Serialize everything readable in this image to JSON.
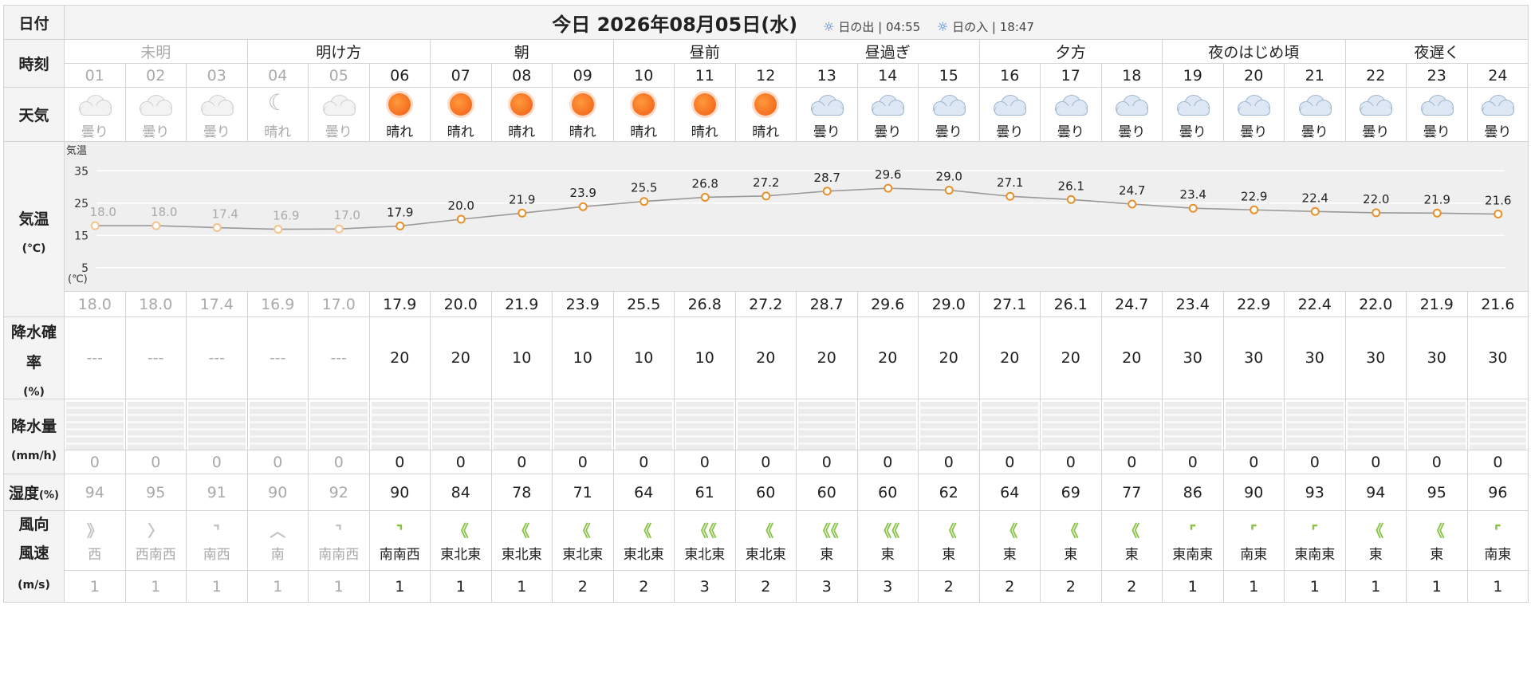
{
  "labels": {
    "date": "日付",
    "time": "時刻",
    "weather": "天気",
    "temp": "気温",
    "temp_unit": "(℃)",
    "precip_prob": "降水確率",
    "precip_prob_unit": "(%)",
    "precip_amt": "降水量",
    "precip_amt_unit": "(mm/h)",
    "humidity": "湿度",
    "humidity_unit": "(%)",
    "wind_dir": "風向",
    "wind_speed": "風速",
    "wind_unit": "(m/s)"
  },
  "header": {
    "title": "今日 2026年08月05日(水)",
    "sunrise_label": "日の出",
    "sunrise_time": "04:55",
    "sunset_label": "日の入",
    "sunset_time": "18:47",
    "separator": "|"
  },
  "periods": [
    {
      "label": "未明",
      "span": 3,
      "dim": true
    },
    {
      "label": "明け方",
      "span": 3,
      "dim": false
    },
    {
      "label": "朝",
      "span": 3,
      "dim": false
    },
    {
      "label": "昼前",
      "span": 3,
      "dim": false
    },
    {
      "label": "昼過ぎ",
      "span": 3,
      "dim": false
    },
    {
      "label": "夕方",
      "span": 3,
      "dim": false
    },
    {
      "label": "夜のはじめ頃",
      "span": 3,
      "dim": false
    },
    {
      "label": "夜遅く",
      "span": 3,
      "dim": false
    }
  ],
  "hours": [
    {
      "hour": "01",
      "past": true,
      "icon": "cloud-icon",
      "weather": "曇り",
      "temp": "18.0",
      "pop": "---",
      "precip": "0",
      "humidity": "94",
      "wind_dir": "西",
      "wind_icon": "wind-arrow-icon",
      "wind_glyph": "》",
      "wind_speed": "1"
    },
    {
      "hour": "02",
      "past": true,
      "icon": "cloud-icon",
      "weather": "曇り",
      "temp": "18.0",
      "pop": "---",
      "precip": "0",
      "humidity": "95",
      "wind_dir": "西南西",
      "wind_icon": "wind-arrow-icon",
      "wind_glyph": "〉",
      "wind_speed": "1"
    },
    {
      "hour": "03",
      "past": true,
      "icon": "cloud-icon",
      "weather": "曇り",
      "temp": "17.4",
      "pop": "---",
      "precip": "0",
      "humidity": "91",
      "wind_dir": "南西",
      "wind_icon": "wind-arrow-icon",
      "wind_glyph": "⌝",
      "wind_speed": "1"
    },
    {
      "hour": "04",
      "past": true,
      "icon": "moon-icon",
      "weather": "晴れ",
      "temp": "16.9",
      "pop": "---",
      "precip": "0",
      "humidity": "90",
      "wind_dir": "南",
      "wind_icon": "wind-arrow-icon",
      "wind_glyph": "︿",
      "wind_speed": "1"
    },
    {
      "hour": "05",
      "past": true,
      "icon": "cloud-icon",
      "weather": "曇り",
      "temp": "17.0",
      "pop": "---",
      "precip": "0",
      "humidity": "92",
      "wind_dir": "南南西",
      "wind_icon": "wind-arrow-icon",
      "wind_glyph": "⌝",
      "wind_speed": "1"
    },
    {
      "hour": "06",
      "past": false,
      "icon": "sun-icon",
      "weather": "晴れ",
      "temp": "17.9",
      "pop": "20",
      "precip": "0",
      "humidity": "90",
      "wind_dir": "南南西",
      "wind_icon": "wind-arrow-icon",
      "wind_glyph": "⌝",
      "wind_speed": "1"
    },
    {
      "hour": "07",
      "past": false,
      "icon": "sun-icon",
      "weather": "晴れ",
      "temp": "20.0",
      "pop": "20",
      "precip": "0",
      "humidity": "84",
      "wind_dir": "東北東",
      "wind_icon": "wind-arrow-icon",
      "wind_glyph": "《",
      "wind_speed": "1"
    },
    {
      "hour": "08",
      "past": false,
      "icon": "sun-icon",
      "weather": "晴れ",
      "temp": "21.9",
      "pop": "10",
      "precip": "0",
      "humidity": "78",
      "wind_dir": "東北東",
      "wind_icon": "wind-arrow-icon",
      "wind_glyph": "《",
      "wind_speed": "1"
    },
    {
      "hour": "09",
      "past": false,
      "icon": "sun-icon",
      "weather": "晴れ",
      "temp": "23.9",
      "pop": "10",
      "precip": "0",
      "humidity": "71",
      "wind_dir": "東北東",
      "wind_icon": "wind-arrow-icon",
      "wind_glyph": "《",
      "wind_speed": "2"
    },
    {
      "hour": "10",
      "past": false,
      "icon": "sun-icon",
      "weather": "晴れ",
      "temp": "25.5",
      "pop": "10",
      "precip": "0",
      "humidity": "64",
      "wind_dir": "東北東",
      "wind_icon": "wind-arrow-icon",
      "wind_glyph": "《",
      "wind_speed": "2"
    },
    {
      "hour": "11",
      "past": false,
      "icon": "sun-icon",
      "weather": "晴れ",
      "temp": "26.8",
      "pop": "10",
      "precip": "0",
      "humidity": "61",
      "wind_dir": "東北東",
      "wind_icon": "wind-arrow-icon",
      "wind_glyph": "《《",
      "wind_speed": "3"
    },
    {
      "hour": "12",
      "past": false,
      "icon": "sun-icon",
      "weather": "晴れ",
      "temp": "27.2",
      "pop": "20",
      "precip": "0",
      "humidity": "60",
      "wind_dir": "東北東",
      "wind_icon": "wind-arrow-icon",
      "wind_glyph": "《",
      "wind_speed": "2"
    },
    {
      "hour": "13",
      "past": false,
      "icon": "cloud-icon",
      "weather": "曇り",
      "temp": "28.7",
      "pop": "20",
      "precip": "0",
      "humidity": "60",
      "wind_dir": "東",
      "wind_icon": "wind-arrow-icon",
      "wind_glyph": "《《",
      "wind_speed": "3"
    },
    {
      "hour": "14",
      "past": false,
      "icon": "cloud-icon",
      "weather": "曇り",
      "temp": "29.6",
      "pop": "20",
      "precip": "0",
      "humidity": "60",
      "wind_dir": "東",
      "wind_icon": "wind-arrow-icon",
      "wind_glyph": "《《",
      "wind_speed": "3"
    },
    {
      "hour": "15",
      "past": false,
      "icon": "cloud-icon",
      "weather": "曇り",
      "temp": "29.0",
      "pop": "20",
      "precip": "0",
      "humidity": "62",
      "wind_dir": "東",
      "wind_icon": "wind-arrow-icon",
      "wind_glyph": "《",
      "wind_speed": "2"
    },
    {
      "hour": "16",
      "past": false,
      "icon": "cloud-icon",
      "weather": "曇り",
      "temp": "27.1",
      "pop": "20",
      "precip": "0",
      "humidity": "64",
      "wind_dir": "東",
      "wind_icon": "wind-arrow-icon",
      "wind_glyph": "《",
      "wind_speed": "2"
    },
    {
      "hour": "17",
      "past": false,
      "icon": "cloud-icon",
      "weather": "曇り",
      "temp": "26.1",
      "pop": "20",
      "precip": "0",
      "humidity": "69",
      "wind_dir": "東",
      "wind_icon": "wind-arrow-icon",
      "wind_glyph": "《",
      "wind_speed": "2"
    },
    {
      "hour": "18",
      "past": false,
      "icon": "cloud-icon",
      "weather": "曇り",
      "temp": "24.7",
      "pop": "20",
      "precip": "0",
      "humidity": "77",
      "wind_dir": "東",
      "wind_icon": "wind-arrow-icon",
      "wind_glyph": "《",
      "wind_speed": "2"
    },
    {
      "hour": "19",
      "past": false,
      "icon": "cloud-icon",
      "weather": "曇り",
      "temp": "23.4",
      "pop": "30",
      "precip": "0",
      "humidity": "86",
      "wind_dir": "東南東",
      "wind_icon": "wind-arrow-icon",
      "wind_glyph": "⌜",
      "wind_speed": "1"
    },
    {
      "hour": "20",
      "past": false,
      "icon": "cloud-icon",
      "weather": "曇り",
      "temp": "22.9",
      "pop": "30",
      "precip": "0",
      "humidity": "90",
      "wind_dir": "南東",
      "wind_icon": "wind-arrow-icon",
      "wind_glyph": "⌜",
      "wind_speed": "1"
    },
    {
      "hour": "21",
      "past": false,
      "icon": "cloud-icon",
      "weather": "曇り",
      "temp": "22.4",
      "pop": "30",
      "precip": "0",
      "humidity": "93",
      "wind_dir": "東南東",
      "wind_icon": "wind-arrow-icon",
      "wind_glyph": "⌜",
      "wind_speed": "1"
    },
    {
      "hour": "22",
      "past": false,
      "icon": "cloud-icon",
      "weather": "曇り",
      "temp": "22.0",
      "pop": "30",
      "precip": "0",
      "humidity": "94",
      "wind_dir": "東",
      "wind_icon": "wind-arrow-icon",
      "wind_glyph": "《",
      "wind_speed": "1"
    },
    {
      "hour": "23",
      "past": false,
      "icon": "cloud-icon",
      "weather": "曇り",
      "temp": "21.9",
      "pop": "30",
      "precip": "0",
      "humidity": "95",
      "wind_dir": "東",
      "wind_icon": "wind-arrow-icon",
      "wind_glyph": "《",
      "wind_speed": "1"
    },
    {
      "hour": "24",
      "past": false,
      "icon": "cloud-icon",
      "weather": "曇り",
      "temp": "21.6",
      "pop": "30",
      "precip": "0",
      "humidity": "96",
      "wind_dir": "南東",
      "wind_icon": "wind-arrow-icon",
      "wind_glyph": "⌜",
      "wind_speed": "1"
    }
  ],
  "colors": {
    "line": "#999999",
    "point_active": "#e8902a",
    "point_past": "#f3c48f",
    "wind_active": "#8bc34a",
    "wind_past": "#c4c4c4",
    "grid": "#ffffff",
    "chart_bg": "#efefef"
  },
  "chart_data": {
    "type": "line",
    "ylabel": "気温",
    "yunit": "(℃)",
    "yticks": [
      35,
      25,
      15,
      5
    ],
    "ylim": [
      0,
      40
    ],
    "grid": true,
    "x": [
      "01",
      "02",
      "03",
      "04",
      "05",
      "06",
      "07",
      "08",
      "09",
      "10",
      "11",
      "12",
      "13",
      "14",
      "15",
      "16",
      "17",
      "18",
      "19",
      "20",
      "21",
      "22",
      "23",
      "24"
    ],
    "series": [
      {
        "values": [
          18.0,
          18.0,
          17.4,
          16.9,
          17.0,
          17.9,
          20.0,
          21.9,
          23.9,
          25.5,
          26.8,
          27.2,
          28.7,
          29.6,
          29.0,
          27.1,
          26.1,
          24.7,
          23.4,
          22.9,
          22.4,
          22.0,
          21.9,
          21.6
        ]
      }
    ]
  }
}
